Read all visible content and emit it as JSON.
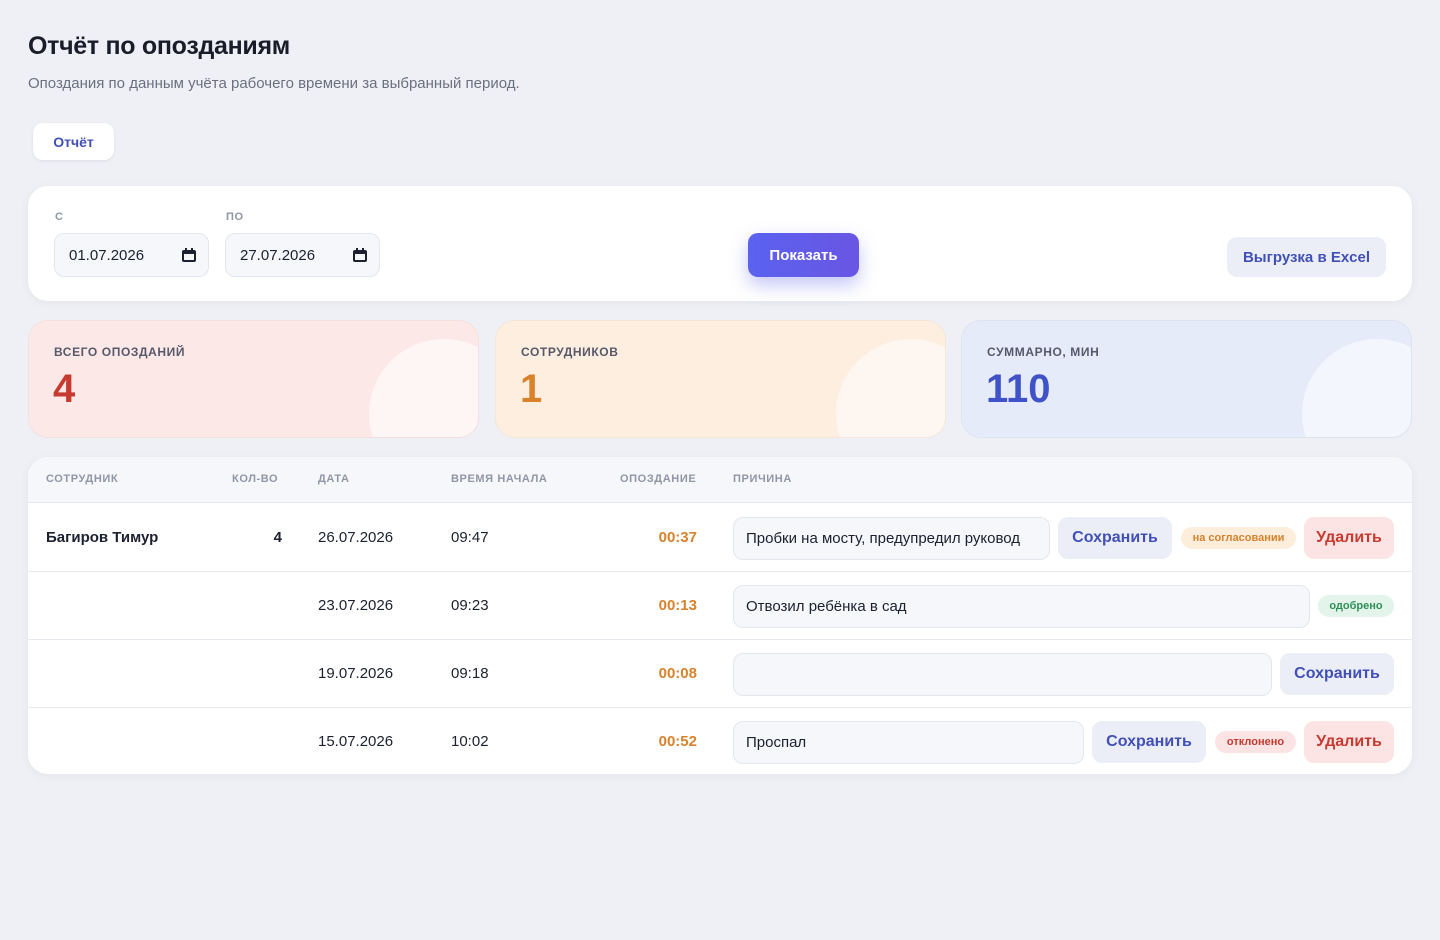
{
  "page": {
    "title": "Отчёт по опозданиям",
    "subtitle": "Опоздания по данным учёта рабочего времени за выбранный период."
  },
  "tabs": [
    {
      "label": "Отчёт",
      "active": true
    }
  ],
  "filters": {
    "from_label": "С",
    "from_value": "01.07.2026",
    "to_label": "ПО",
    "to_value": "27.07.2026",
    "show_button": "Показать",
    "export_button": "Выгрузка в Excel"
  },
  "stats": [
    {
      "label": "ВСЕГО ОПОЗДАНИЙ",
      "value": "4",
      "color": "#c63a30"
    },
    {
      "label": "СОТРУДНИКОВ",
      "value": "1",
      "color": "#d8822c"
    },
    {
      "label": "СУММАРНО, МИН",
      "value": "110",
      "color": "#3f52c8"
    }
  ],
  "table": {
    "headers": {
      "employee": "СОТРУДНИК",
      "count": "КОЛ-ВО",
      "date": "ДАТА",
      "start_time": "ВРЕМЯ НАЧАЛА",
      "late": "ОПОЗДАНИЕ",
      "reason": "ПРИЧИНА"
    },
    "rows": [
      {
        "employee": "Багиров Тимур",
        "count": "4",
        "date": "26.07.2026",
        "start_time": "09:47",
        "late": "00:37",
        "reason": "Пробки на мосту, предупредил руковод",
        "save": "Сохранить",
        "status": "на согласовании",
        "delete": "Удалить"
      },
      {
        "employee": "",
        "count": "",
        "date": "23.07.2026",
        "start_time": "09:23",
        "late": "00:13",
        "reason": "Отвозил ребёнка в сад",
        "status": "одобрено"
      },
      {
        "employee": "",
        "count": "",
        "date": "19.07.2026",
        "start_time": "09:18",
        "late": "00:08",
        "reason": "",
        "save": "Сохранить"
      },
      {
        "employee": "",
        "count": "",
        "date": "15.07.2026",
        "start_time": "10:02",
        "late": "00:52",
        "reason": "Проспал",
        "save": "Сохранить",
        "status": "отклонено",
        "delete": "Удалить"
      }
    ]
  },
  "colors": {
    "accent": "#5a62ef",
    "late": "#d8822c",
    "danger": "#c63a30",
    "success": "#2f9158"
  }
}
